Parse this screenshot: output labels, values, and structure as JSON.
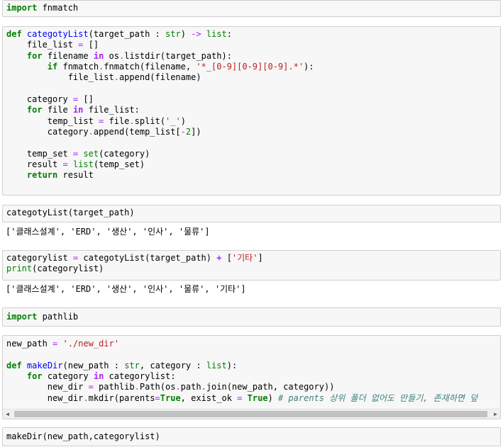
{
  "cells": [
    {
      "id": "cell-1",
      "lines": [
        [
          [
            "kw",
            "import"
          ],
          [
            "t",
            " fnmatch"
          ]
        ]
      ]
    },
    {
      "id": "cell-2",
      "lines": [
        [
          [
            "kw",
            "def"
          ],
          [
            "t",
            " "
          ],
          [
            "fn",
            "categotyList"
          ],
          [
            "t",
            "(target_path : "
          ],
          [
            "bi",
            "str"
          ],
          [
            "t",
            ") "
          ],
          [
            "opn",
            "->"
          ],
          [
            "t",
            " "
          ],
          [
            "bi",
            "list"
          ],
          [
            "t",
            ":"
          ]
        ],
        [
          [
            "t",
            "    file_list "
          ],
          [
            "opn",
            "="
          ],
          [
            "t",
            " []"
          ]
        ],
        [
          [
            "t",
            "    "
          ],
          [
            "kw",
            "for"
          ],
          [
            "t",
            " filename "
          ],
          [
            "op",
            "in"
          ],
          [
            "t",
            " os"
          ],
          [
            "opn",
            "."
          ],
          [
            "t",
            "listdir(target_path):"
          ]
        ],
        [
          [
            "t",
            "        "
          ],
          [
            "kw",
            "if"
          ],
          [
            "t",
            " fnmatch"
          ],
          [
            "opn",
            "."
          ],
          [
            "t",
            "fnmatch(filename, "
          ],
          [
            "str",
            "'*_[0-9][0-9][0-9].*'"
          ],
          [
            "t",
            "):"
          ]
        ],
        [
          [
            "t",
            "            file_list"
          ],
          [
            "opn",
            "."
          ],
          [
            "t",
            "append(filename)"
          ]
        ],
        [
          [
            "t",
            ""
          ]
        ],
        [
          [
            "t",
            "    category "
          ],
          [
            "opn",
            "="
          ],
          [
            "t",
            " []"
          ]
        ],
        [
          [
            "t",
            "    "
          ],
          [
            "kw",
            "for"
          ],
          [
            "t",
            " file "
          ],
          [
            "op",
            "in"
          ],
          [
            "t",
            " file_list:"
          ]
        ],
        [
          [
            "t",
            "        temp_list "
          ],
          [
            "opn",
            "="
          ],
          [
            "t",
            " file"
          ],
          [
            "opn",
            "."
          ],
          [
            "t",
            "split("
          ],
          [
            "str",
            "'_'"
          ],
          [
            "t",
            ")"
          ]
        ],
        [
          [
            "t",
            "        category"
          ],
          [
            "opn",
            "."
          ],
          [
            "t",
            "append(temp_list["
          ],
          [
            "opn",
            "-"
          ],
          [
            "num",
            "2"
          ],
          [
            "t",
            "])"
          ]
        ],
        [
          [
            "t",
            ""
          ]
        ],
        [
          [
            "t",
            "    temp_set "
          ],
          [
            "opn",
            "="
          ],
          [
            "t",
            " "
          ],
          [
            "bi",
            "set"
          ],
          [
            "t",
            "(category)"
          ]
        ],
        [
          [
            "t",
            "    result "
          ],
          [
            "opn",
            "="
          ],
          [
            "t",
            " "
          ],
          [
            "bi",
            "list"
          ],
          [
            "t",
            "(temp_set)"
          ]
        ],
        [
          [
            "t",
            "    "
          ],
          [
            "kw",
            "return"
          ],
          [
            "t",
            " result"
          ]
        ],
        [
          [
            "t",
            ""
          ]
        ]
      ]
    },
    {
      "id": "cell-3",
      "lines": [
        [
          [
            "t",
            "categotyList(target_path)"
          ]
        ]
      ]
    },
    {
      "id": "cell-4",
      "lines": [
        [
          [
            "t",
            "categorylist "
          ],
          [
            "opn",
            "="
          ],
          [
            "t",
            " categotyList(target_path) "
          ],
          [
            "op",
            "+"
          ],
          [
            "t",
            " ["
          ],
          [
            "str",
            "'기타'"
          ],
          [
            "t",
            "]"
          ]
        ],
        [
          [
            "bi",
            "print"
          ],
          [
            "t",
            "(categorylist)"
          ]
        ]
      ]
    },
    {
      "id": "cell-5",
      "lines": [
        [
          [
            "kw",
            "import"
          ],
          [
            "t",
            " pathlib"
          ]
        ]
      ]
    },
    {
      "id": "cell-6",
      "lines": [
        [
          [
            "t",
            "new_path "
          ],
          [
            "opn",
            "="
          ],
          [
            "t",
            " "
          ],
          [
            "str",
            "'./new_dir'"
          ]
        ],
        [
          [
            "t",
            ""
          ]
        ],
        [
          [
            "kw",
            "def"
          ],
          [
            "t",
            " "
          ],
          [
            "fn",
            "makeDir"
          ],
          [
            "t",
            "(new_path : "
          ],
          [
            "bi",
            "str"
          ],
          [
            "t",
            ", category : "
          ],
          [
            "bi",
            "list"
          ],
          [
            "t",
            "):"
          ]
        ],
        [
          [
            "t",
            "    "
          ],
          [
            "kw",
            "for"
          ],
          [
            "t",
            " category "
          ],
          [
            "op",
            "in"
          ],
          [
            "t",
            " categorylist:"
          ]
        ],
        [
          [
            "t",
            "        new_dir "
          ],
          [
            "opn",
            "="
          ],
          [
            "t",
            " pathlib"
          ],
          [
            "opn",
            "."
          ],
          [
            "t",
            "Path(os"
          ],
          [
            "opn",
            "."
          ],
          [
            "t",
            "path"
          ],
          [
            "opn",
            "."
          ],
          [
            "t",
            "join(new_path, category))"
          ]
        ],
        [
          [
            "t",
            "        new_dir"
          ],
          [
            "opn",
            "."
          ],
          [
            "t",
            "mkdir(parents"
          ],
          [
            "opn",
            "="
          ],
          [
            "kw",
            "True"
          ],
          [
            "t",
            ", exist_ok "
          ],
          [
            "opn",
            "="
          ],
          [
            "t",
            " "
          ],
          [
            "kw",
            "True"
          ],
          [
            "t",
            ") "
          ],
          [
            "cm",
            "# parents 상위 폴더 없어도 만들기, 존재하면 덮"
          ]
        ]
      ]
    },
    {
      "id": "cell-7",
      "lines": [
        [
          [
            "t",
            "makeDir(new_path,categorylist)"
          ]
        ]
      ]
    }
  ],
  "outputs": {
    "out_1": "['클래스설계', 'ERD', '생산', '인사', '물류']",
    "out_2": "['클래스설계', 'ERD', '생산', '인사', '물류', '기타']"
  },
  "scrollbar": {
    "left_arrow": "◀",
    "right_arrow": "▶"
  }
}
